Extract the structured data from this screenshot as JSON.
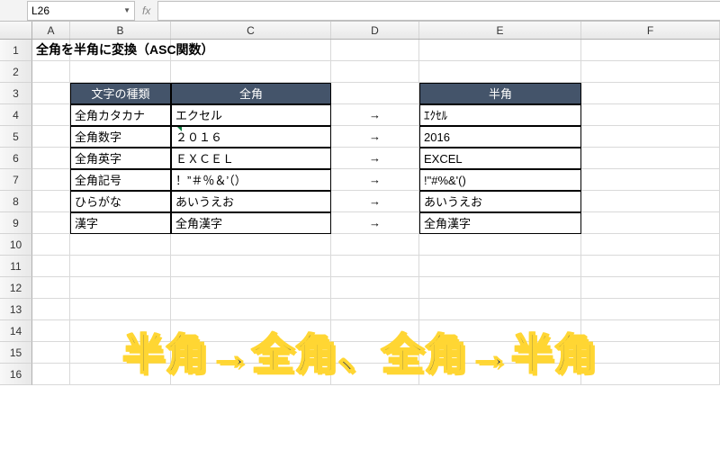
{
  "name_box": "L26",
  "fx_label": "fx",
  "formula_value": "",
  "columns": [
    "A",
    "B",
    "C",
    "D",
    "E",
    "F"
  ],
  "rows": [
    "1",
    "2",
    "3",
    "4",
    "5",
    "6",
    "7",
    "8",
    "9",
    "10",
    "11",
    "12",
    "13",
    "14",
    "15",
    "16"
  ],
  "title": "全角を半角に変換（ASC関数）",
  "table": {
    "headers": {
      "type": "文字の種類",
      "fullwidth": "全角",
      "halfwidth": "半角"
    },
    "arrow": "→",
    "data": [
      {
        "type": "全角カタカナ",
        "full": "エクセル",
        "half": "ｴｸｾﾙ"
      },
      {
        "type": "全角数字",
        "full": "２０１６",
        "half": "2016"
      },
      {
        "type": "全角英字",
        "full": "ＥＸＣＥＬ",
        "half": "EXCEL"
      },
      {
        "type": "全角記号",
        "full": "！”＃％＆’（）",
        "half": "!\"#%&'()"
      },
      {
        "type": "ひらがな",
        "full": "あいうえお",
        "half": "あいうえお"
      },
      {
        "type": "漢字",
        "full": "全角漢字",
        "half": "全角漢字"
      }
    ]
  },
  "overlay_text": "半角→全角、全角→半角"
}
